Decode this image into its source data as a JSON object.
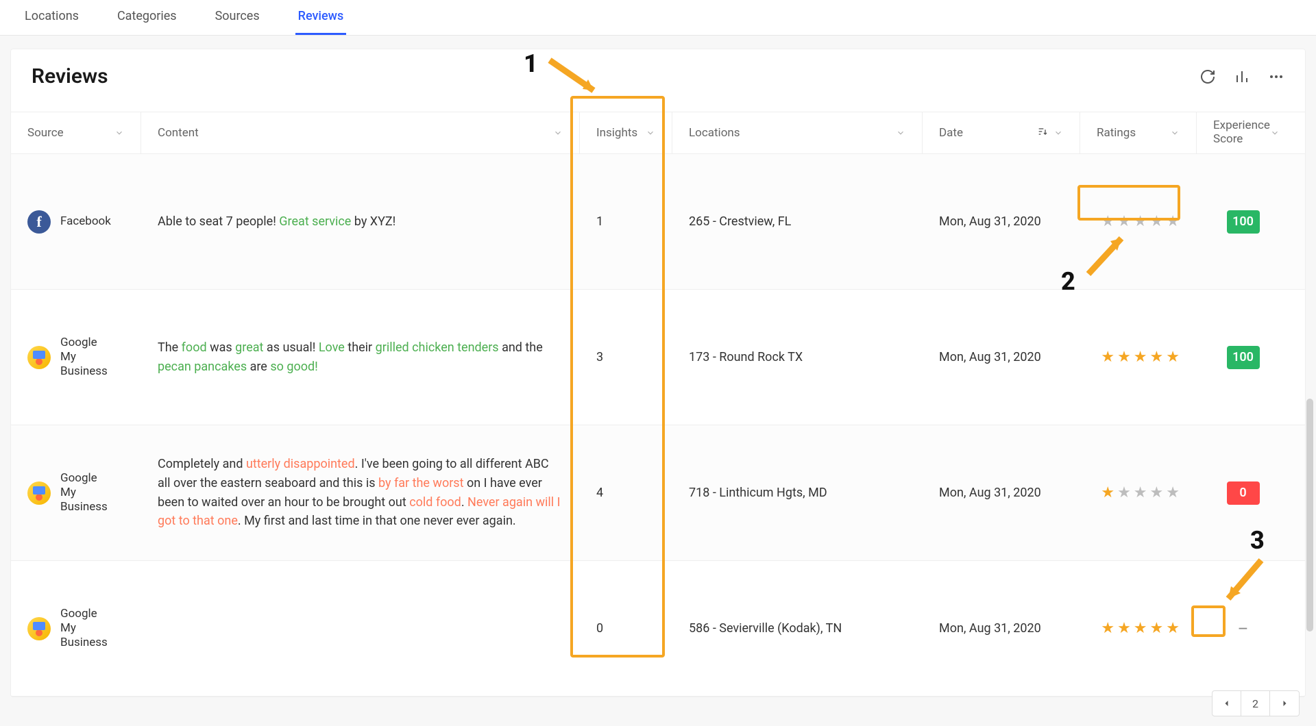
{
  "nav": {
    "tabs": [
      "Locations",
      "Categories",
      "Sources",
      "Reviews"
    ],
    "active_index": 3
  },
  "page": {
    "title": "Reviews"
  },
  "columns": {
    "source": "Source",
    "content": "Content",
    "insights": "Insights",
    "locations": "Locations",
    "date": "Date",
    "ratings": "Ratings",
    "score": "Experience Score"
  },
  "rows": [
    {
      "source_type": "facebook",
      "source_label": "Facebook",
      "content_segments": [
        {
          "t": "Able to seat 7 people! ",
          "s": ""
        },
        {
          "t": "Great service",
          "s": "pos"
        },
        {
          "t": " by XYZ!",
          "s": ""
        }
      ],
      "insights": "1",
      "location": "265 - Crestview, FL",
      "date": "Mon, Aug 31, 2020",
      "rating": 0,
      "score": "100",
      "score_class": "good"
    },
    {
      "source_type": "gmb",
      "source_label": "Google My Business",
      "content_segments": [
        {
          "t": "The ",
          "s": ""
        },
        {
          "t": "food",
          "s": "pos"
        },
        {
          "t": " was ",
          "s": ""
        },
        {
          "t": "great",
          "s": "pos"
        },
        {
          "t": " as usual! ",
          "s": ""
        },
        {
          "t": "Love",
          "s": "pos"
        },
        {
          "t": " their ",
          "s": ""
        },
        {
          "t": "grilled chicken tenders",
          "s": "pos"
        },
        {
          "t": " and the ",
          "s": ""
        },
        {
          "t": "pecan pancakes",
          "s": "pos"
        },
        {
          "t": " are ",
          "s": ""
        },
        {
          "t": "so good!",
          "s": "pos"
        }
      ],
      "insights": "3",
      "location": "173 - Round Rock TX",
      "date": "Mon, Aug 31, 2020",
      "rating": 5,
      "score": "100",
      "score_class": "good"
    },
    {
      "source_type": "gmb",
      "source_label": "Google My Business",
      "content_segments": [
        {
          "t": "Completely and ",
          "s": ""
        },
        {
          "t": "utterly disappointed",
          "s": "neg"
        },
        {
          "t": ". I've been going to all different ABC all over the eastern seaboard and this is ",
          "s": ""
        },
        {
          "t": "by far the worst",
          "s": "neg"
        },
        {
          "t": " on I have ever been to waited over an hour to be brought out ",
          "s": ""
        },
        {
          "t": "cold food",
          "s": "neg"
        },
        {
          "t": ". ",
          "s": ""
        },
        {
          "t": "Never again will I got to that one",
          "s": "neg"
        },
        {
          "t": ". My first and last time in that one never ever again.",
          "s": ""
        }
      ],
      "insights": "4",
      "location": "718 - Linthicum Hgts, MD",
      "date": "Mon, Aug 31, 2020",
      "rating": 1,
      "score": "0",
      "score_class": "bad"
    },
    {
      "source_type": "gmb",
      "source_label": "Google My Business",
      "content_segments": [],
      "insights": "0",
      "location": "586 - Sevierville (Kodak), TN",
      "date": "Mon, Aug 31, 2020",
      "rating": 5,
      "score": "–",
      "score_class": "none"
    }
  ],
  "pager": {
    "page": "2"
  },
  "annotations": {
    "labels": {
      "a1": "1",
      "a2": "2",
      "a3": "3"
    }
  }
}
